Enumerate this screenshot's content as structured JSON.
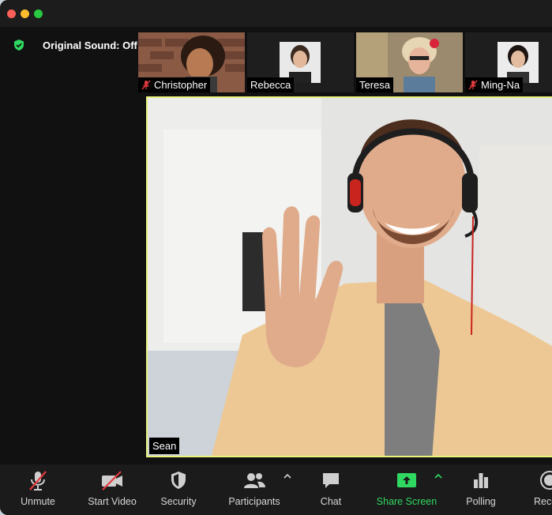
{
  "sound": {
    "label": "Original Sound: Off"
  },
  "participants": [
    {
      "name": "Christopher",
      "muted": true
    },
    {
      "name": "Rebecca",
      "muted": false
    },
    {
      "name": "Teresa",
      "muted": false
    },
    {
      "name": "Ming-Na",
      "muted": true
    }
  ],
  "speaker": {
    "name": "Sean"
  },
  "toolbar": {
    "unmute": "Unmute",
    "start_video": "Start Video",
    "security": "Security",
    "participants": "Participants",
    "chat": "Chat",
    "share_screen": "Share Screen",
    "polling": "Polling",
    "record": "Reco"
  },
  "colors": {
    "active_speaker_border": "#e8f27a",
    "share_green": "#2fd860",
    "mute_red": "#e0393e"
  }
}
